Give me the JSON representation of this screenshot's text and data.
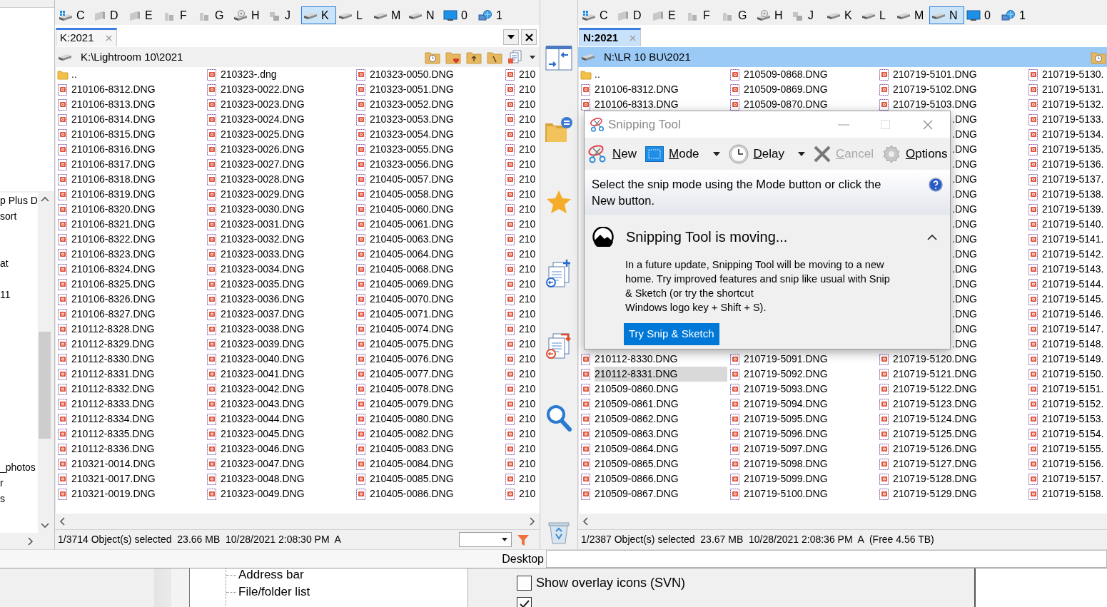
{
  "left_panel": {
    "tree_items": [
      "p Plus D",
      "sort",
      "at",
      "11",
      "_photos",
      "r",
      "s"
    ]
  },
  "panes": [
    {
      "active": false,
      "drives": [
        {
          "letter": "C",
          "kind": "system",
          "selected": false
        },
        {
          "letter": "D",
          "kind": "fixed",
          "selected": false
        },
        {
          "letter": "E",
          "kind": "fixed",
          "selected": false
        },
        {
          "letter": "F",
          "kind": "removable",
          "selected": false
        },
        {
          "letter": "G",
          "kind": "removable",
          "selected": false
        },
        {
          "letter": "H",
          "kind": "optical",
          "selected": false
        },
        {
          "letter": "J",
          "kind": "network",
          "selected": false
        },
        {
          "letter": "K",
          "kind": "hdd",
          "selected": true
        },
        {
          "letter": "L",
          "kind": "hdd",
          "selected": false
        },
        {
          "letter": "M",
          "kind": "hdd",
          "selected": false
        },
        {
          "letter": "N",
          "kind": "hdd",
          "selected": false
        },
        {
          "letter": "0",
          "kind": "desktop",
          "selected": false
        },
        {
          "letter": "1",
          "kind": "globe",
          "selected": false
        }
      ],
      "tab": "K:2021",
      "path": "K:\\Lightroom 10\\2021",
      "columns": [
        {
          "top": [
            {
              "name": "..",
              "kind": "up",
              "selected": false
            },
            {
              "name": "210106-8312.DNG",
              "kind": "file",
              "selected": false
            },
            {
              "name": "210106-8313.DNG",
              "kind": "file",
              "selected": false
            },
            {
              "name": "210106-8314.DNG",
              "kind": "file",
              "selected": false
            },
            {
              "name": "210106-8315.DNG",
              "kind": "file",
              "selected": false
            },
            {
              "name": "210106-8316.DNG",
              "kind": "file",
              "selected": false
            },
            {
              "name": "210106-8317.DNG",
              "kind": "file",
              "selected": false
            },
            {
              "name": "210106-8318.DNG",
              "kind": "file",
              "selected": false
            },
            {
              "name": "210106-8319.DNG",
              "kind": "file",
              "selected": false
            },
            {
              "name": "210106-8320.DNG",
              "kind": "file",
              "selected": false
            },
            {
              "name": "210106-8321.DNG",
              "kind": "file",
              "selected": false
            },
            {
              "name": "210106-8322.DNG",
              "kind": "file",
              "selected": false
            },
            {
              "name": "210106-8323.DNG",
              "kind": "file",
              "selected": false
            },
            {
              "name": "210106-8324.DNG",
              "kind": "file",
              "selected": false
            },
            {
              "name": "210106-8325.DNG",
              "kind": "file",
              "selected": false
            },
            {
              "name": "210106-8326.DNG",
              "kind": "file",
              "selected": false
            },
            {
              "name": "210106-8327.DNG",
              "kind": "file",
              "selected": false
            },
            {
              "name": "210112-8328.DNG",
              "kind": "file",
              "selected": false
            },
            {
              "name": "210112-8329.DNG",
              "kind": "file",
              "selected": false
            },
            {
              "name": "210112-8330.DNG",
              "kind": "file",
              "selected": false
            },
            {
              "name": "210112-8331.DNG",
              "kind": "file",
              "selected": false
            },
            {
              "name": "210112-8332.DNG",
              "kind": "file",
              "selected": false
            },
            {
              "name": "210112-8333.DNG",
              "kind": "file",
              "selected": false
            },
            {
              "name": "210112-8334.DNG",
              "kind": "file",
              "selected": false
            },
            {
              "name": "210112-8335.DNG",
              "kind": "file",
              "selected": false
            },
            {
              "name": "210112-8336.DNG",
              "kind": "file",
              "selected": false
            },
            {
              "name": "210321-0014.DNG",
              "kind": "file",
              "selected": false
            },
            {
              "name": "210321-0017.DNG",
              "kind": "file",
              "selected": false
            },
            {
              "name": "210321-0019.DNG",
              "kind": "file",
              "selected": false
            }
          ]
        },
        {
          "top": [
            {
              "name": "210323-.dng",
              "kind": "file",
              "selected": false
            },
            {
              "name": "210323-0022.DNG",
              "kind": "file",
              "selected": false
            },
            {
              "name": "210323-0023.DNG",
              "kind": "file",
              "selected": false
            },
            {
              "name": "210323-0024.DNG",
              "kind": "file",
              "selected": false
            },
            {
              "name": "210323-0025.DNG",
              "kind": "file",
              "selected": false
            },
            {
              "name": "210323-0026.DNG",
              "kind": "file",
              "selected": false
            },
            {
              "name": "210323-0027.DNG",
              "kind": "file",
              "selected": false
            },
            {
              "name": "210323-0028.DNG",
              "kind": "file",
              "selected": false
            },
            {
              "name": "210323-0029.DNG",
              "kind": "file",
              "selected": false
            },
            {
              "name": "210323-0030.DNG",
              "kind": "file",
              "selected": false
            },
            {
              "name": "210323-0031.DNG",
              "kind": "file",
              "selected": false
            },
            {
              "name": "210323-0032.DNG",
              "kind": "file",
              "selected": false
            },
            {
              "name": "210323-0033.DNG",
              "kind": "file",
              "selected": false
            },
            {
              "name": "210323-0034.DNG",
              "kind": "file",
              "selected": false
            },
            {
              "name": "210323-0035.DNG",
              "kind": "file",
              "selected": false
            },
            {
              "name": "210323-0036.DNG",
              "kind": "file",
              "selected": false
            },
            {
              "name": "210323-0037.DNG",
              "kind": "file",
              "selected": false
            },
            {
              "name": "210323-0038.DNG",
              "kind": "file",
              "selected": false
            },
            {
              "name": "210323-0039.DNG",
              "kind": "file",
              "selected": false
            },
            {
              "name": "210323-0040.DNG",
              "kind": "file",
              "selected": false
            },
            {
              "name": "210323-0041.DNG",
              "kind": "file",
              "selected": false
            },
            {
              "name": "210323-0042.DNG",
              "kind": "file",
              "selected": false
            },
            {
              "name": "210323-0043.DNG",
              "kind": "file",
              "selected": false
            },
            {
              "name": "210323-0044.DNG",
              "kind": "file",
              "selected": false
            },
            {
              "name": "210323-0045.DNG",
              "kind": "file",
              "selected": false
            },
            {
              "name": "210323-0046.DNG",
              "kind": "file",
              "selected": false
            },
            {
              "name": "210323-0047.DNG",
              "kind": "file",
              "selected": false
            },
            {
              "name": "210323-0048.DNG",
              "kind": "file",
              "selected": false
            },
            {
              "name": "210323-0049.DNG",
              "kind": "file",
              "selected": false
            }
          ]
        },
        {
          "top": [
            {
              "name": "210323-0050.DNG",
              "kind": "file",
              "selected": false
            },
            {
              "name": "210323-0051.DNG",
              "kind": "file",
              "selected": false
            },
            {
              "name": "210323-0052.DNG",
              "kind": "file",
              "selected": false
            },
            {
              "name": "210323-0053.DNG",
              "kind": "file",
              "selected": false
            },
            {
              "name": "210323-0054.DNG",
              "kind": "file",
              "selected": false
            },
            {
              "name": "210323-0055.DNG",
              "kind": "file",
              "selected": false
            },
            {
              "name": "210323-0056.DNG",
              "kind": "file",
              "selected": false
            },
            {
              "name": "210405-0057.DNG",
              "kind": "file",
              "selected": false
            },
            {
              "name": "210405-0058.DNG",
              "kind": "file",
              "selected": false
            },
            {
              "name": "210405-0060.DNG",
              "kind": "file",
              "selected": false
            },
            {
              "name": "210405-0061.DNG",
              "kind": "file",
              "selected": false
            },
            {
              "name": "210405-0063.DNG",
              "kind": "file",
              "selected": false
            },
            {
              "name": "210405-0064.DNG",
              "kind": "file",
              "selected": false
            },
            {
              "name": "210405-0068.DNG",
              "kind": "file",
              "selected": false
            },
            {
              "name": "210405-0069.DNG",
              "kind": "file",
              "selected": false
            },
            {
              "name": "210405-0070.DNG",
              "kind": "file",
              "selected": false
            },
            {
              "name": "210405-0071.DNG",
              "kind": "file",
              "selected": false
            },
            {
              "name": "210405-0074.DNG",
              "kind": "file",
              "selected": false
            },
            {
              "name": "210405-0075.DNG",
              "kind": "file",
              "selected": false
            },
            {
              "name": "210405-0076.DNG",
              "kind": "file",
              "selected": false
            },
            {
              "name": "210405-0077.DNG",
              "kind": "file",
              "selected": false
            },
            {
              "name": "210405-0078.DNG",
              "kind": "file",
              "selected": false
            },
            {
              "name": "210405-0079.DNG",
              "kind": "file",
              "selected": false
            },
            {
              "name": "210405-0080.DNG",
              "kind": "file",
              "selected": false
            },
            {
              "name": "210405-0082.DNG",
              "kind": "file",
              "selected": false
            },
            {
              "name": "210405-0083.DNG",
              "kind": "file",
              "selected": false
            },
            {
              "name": "210405-0084.DNG",
              "kind": "file",
              "selected": false
            },
            {
              "name": "210405-0085.DNG",
              "kind": "file",
              "selected": false
            },
            {
              "name": "210405-0086.DNG",
              "kind": "file",
              "selected": false
            }
          ]
        },
        {
          "top": [
            {
              "name": "210",
              "kind": "file",
              "selected": false
            },
            {
              "name": "210",
              "kind": "file",
              "selected": false
            },
            {
              "name": "210",
              "kind": "file",
              "selected": false
            },
            {
              "name": "210",
              "kind": "file",
              "selected": false
            },
            {
              "name": "210",
              "kind": "file",
              "selected": false
            },
            {
              "name": "210",
              "kind": "file",
              "selected": false
            },
            {
              "name": "210",
              "kind": "file",
              "selected": false
            },
            {
              "name": "210",
              "kind": "file",
              "selected": false
            },
            {
              "name": "210",
              "kind": "file",
              "selected": false
            },
            {
              "name": "210",
              "kind": "file",
              "selected": false
            },
            {
              "name": "210",
              "kind": "file",
              "selected": false
            },
            {
              "name": "210",
              "kind": "file",
              "selected": false
            },
            {
              "name": "210",
              "kind": "file",
              "selected": false
            },
            {
              "name": "210",
              "kind": "file",
              "selected": false
            },
            {
              "name": "210",
              "kind": "file",
              "selected": false
            },
            {
              "name": "210",
              "kind": "file",
              "selected": false
            },
            {
              "name": "210",
              "kind": "file",
              "selected": false
            },
            {
              "name": "210",
              "kind": "file",
              "selected": false
            },
            {
              "name": "210",
              "kind": "file",
              "selected": false
            },
            {
              "name": "210",
              "kind": "file",
              "selected": false
            },
            {
              "name": "210",
              "kind": "file",
              "selected": false
            },
            {
              "name": "210",
              "kind": "file",
              "selected": false
            },
            {
              "name": "210",
              "kind": "file",
              "selected": false
            },
            {
              "name": "210",
              "kind": "file",
              "selected": false
            },
            {
              "name": "210",
              "kind": "file",
              "selected": false
            },
            {
              "name": "210",
              "kind": "file",
              "selected": false
            },
            {
              "name": "210",
              "kind": "file",
              "selected": false
            },
            {
              "name": "210",
              "kind": "file",
              "selected": false
            },
            {
              "name": "210",
              "kind": "file",
              "selected": false
            }
          ]
        }
      ],
      "status": "1/3714 Object(s) selected  23.66 MB  10/28/2021 2:08:30 PM  A"
    },
    {
      "active": true,
      "drives": [
        {
          "letter": "C",
          "kind": "system",
          "selected": false
        },
        {
          "letter": "D",
          "kind": "fixed",
          "selected": false
        },
        {
          "letter": "E",
          "kind": "fixed",
          "selected": false
        },
        {
          "letter": "F",
          "kind": "removable",
          "selected": false
        },
        {
          "letter": "G",
          "kind": "removable",
          "selected": false
        },
        {
          "letter": "H",
          "kind": "optical",
          "selected": false
        },
        {
          "letter": "J",
          "kind": "network",
          "selected": false
        },
        {
          "letter": "K",
          "kind": "hdd",
          "selected": false
        },
        {
          "letter": "L",
          "kind": "hdd",
          "selected": false
        },
        {
          "letter": "M",
          "kind": "hdd",
          "selected": false
        },
        {
          "letter": "N",
          "kind": "hdd",
          "selected": true
        },
        {
          "letter": "0",
          "kind": "desktop",
          "selected": false
        },
        {
          "letter": "1",
          "kind": "globe",
          "selected": false
        }
      ],
      "tab": "N:2021",
      "path": "N:\\LR 10 BU\\2021",
      "columns": [
        {
          "top": [
            {
              "name": "..",
              "kind": "up",
              "selected": false
            },
            {
              "name": "210106-8312.DNG",
              "kind": "file",
              "selected": false
            },
            {
              "name": "210106-8313.DNG",
              "kind": "file",
              "selected": false
            }
          ],
          "bottom": [
            {
              "name": "210112-8330.DNG",
              "kind": "file",
              "selected": false
            },
            {
              "name": "210112-8331.DNG",
              "kind": "file",
              "selected": true
            },
            {
              "name": "210509-0860.DNG",
              "kind": "file",
              "selected": false
            },
            {
              "name": "210509-0861.DNG",
              "kind": "file",
              "selected": false
            },
            {
              "name": "210509-0862.DNG",
              "kind": "file",
              "selected": false
            },
            {
              "name": "210509-0863.DNG",
              "kind": "file",
              "selected": false
            },
            {
              "name": "210509-0864.DNG",
              "kind": "file",
              "selected": false
            },
            {
              "name": "210509-0865.DNG",
              "kind": "file",
              "selected": false
            },
            {
              "name": "210509-0866.DNG",
              "kind": "file",
              "selected": false
            },
            {
              "name": "210509-0867.DNG",
              "kind": "file",
              "selected": false
            }
          ]
        },
        {
          "top": [
            {
              "name": "210509-0868.DNG",
              "kind": "file",
              "selected": false
            },
            {
              "name": "210509-0869.DNG",
              "kind": "file",
              "selected": false
            },
            {
              "name": "210509-0870.DNG",
              "kind": "file",
              "selected": false
            }
          ],
          "bottom": [
            {
              "name": "210719-5091.DNG",
              "kind": "file",
              "selected": false
            },
            {
              "name": "210719-5092.DNG",
              "kind": "file",
              "selected": false
            },
            {
              "name": "210719-5093.DNG",
              "kind": "file",
              "selected": false
            },
            {
              "name": "210719-5094.DNG",
              "kind": "file",
              "selected": false
            },
            {
              "name": "210719-5095.DNG",
              "kind": "file",
              "selected": false
            },
            {
              "name": "210719-5096.DNG",
              "kind": "file",
              "selected": false
            },
            {
              "name": "210719-5097.DNG",
              "kind": "file",
              "selected": false
            },
            {
              "name": "210719-5098.DNG",
              "kind": "file",
              "selected": false
            },
            {
              "name": "210719-5099.DNG",
              "kind": "file",
              "selected": false
            },
            {
              "name": "210719-5100.DNG",
              "kind": "file",
              "selected": false
            }
          ]
        },
        {
          "top": [
            {
              "name": "210719-5101.DNG",
              "kind": "file",
              "selected": false
            },
            {
              "name": "210719-5102.DNG",
              "kind": "file",
              "selected": false
            },
            {
              "name": "210719-5103.DNG",
              "kind": "file",
              "selected": false
            },
            {
              "name": ".DNG",
              "kind": "clipped",
              "selected": false
            },
            {
              "name": ".DNG",
              "kind": "clipped",
              "selected": false
            },
            {
              "name": ".DNG",
              "kind": "clipped",
              "selected": false
            },
            {
              "name": ".DNG",
              "kind": "clipped",
              "selected": false
            },
            {
              "name": ".DNG",
              "kind": "clipped",
              "selected": false
            },
            {
              "name": ".DNG",
              "kind": "clipped",
              "selected": false
            },
            {
              "name": ".DNG",
              "kind": "clipped",
              "selected": false
            },
            {
              "name": ".DNG",
              "kind": "clipped",
              "selected": false
            },
            {
              "name": ".DNG",
              "kind": "clipped",
              "selected": false
            },
            {
              "name": ".DNG",
              "kind": "clipped",
              "selected": false
            },
            {
              "name": ".DNG",
              "kind": "clipped",
              "selected": false
            },
            {
              "name": ".DNG",
              "kind": "clipped",
              "selected": false
            },
            {
              "name": ".DNG",
              "kind": "clipped",
              "selected": false
            },
            {
              "name": ".DNG",
              "kind": "clipped",
              "selected": false
            },
            {
              "name": ".DNG",
              "kind": "clipped",
              "selected": false
            },
            {
              "name": ".DNG",
              "kind": "clipped",
              "selected": false
            },
            {
              "name": "210719-5120.DNG",
              "kind": "file",
              "selected": false
            },
            {
              "name": "210719-5121.DNG",
              "kind": "file",
              "selected": false
            },
            {
              "name": "210719-5122.DNG",
              "kind": "file",
              "selected": false
            },
            {
              "name": "210719-5123.DNG",
              "kind": "file",
              "selected": false
            },
            {
              "name": "210719-5124.DNG",
              "kind": "file",
              "selected": false
            },
            {
              "name": "210719-5125.DNG",
              "kind": "file",
              "selected": false
            },
            {
              "name": "210719-5126.DNG",
              "kind": "file",
              "selected": false
            },
            {
              "name": "210719-5127.DNG",
              "kind": "file",
              "selected": false
            },
            {
              "name": "210719-5128.DNG",
              "kind": "file",
              "selected": false
            },
            {
              "name": "210719-5129.DNG",
              "kind": "file",
              "selected": false
            }
          ]
        },
        {
          "top": [
            {
              "name": "210719-5130.",
              "kind": "file",
              "selected": false
            },
            {
              "name": "210719-5131.",
              "kind": "file",
              "selected": false
            },
            {
              "name": "210719-5132.",
              "kind": "file",
              "selected": false
            },
            {
              "name": "210719-5133.",
              "kind": "file",
              "selected": false
            },
            {
              "name": "210719-5134.",
              "kind": "file",
              "selected": false
            },
            {
              "name": "210719-5135.",
              "kind": "file",
              "selected": false
            },
            {
              "name": "210719-5136.",
              "kind": "file",
              "selected": false
            },
            {
              "name": "210719-5137.",
              "kind": "file",
              "selected": false
            },
            {
              "name": "210719-5138.",
              "kind": "file",
              "selected": false
            },
            {
              "name": "210719-5139.",
              "kind": "file",
              "selected": false
            },
            {
              "name": "210719-5140.",
              "kind": "file",
              "selected": false
            },
            {
              "name": "210719-5141.",
              "kind": "file",
              "selected": false
            },
            {
              "name": "210719-5142.",
              "kind": "file",
              "selected": false
            },
            {
              "name": "210719-5143.",
              "kind": "file",
              "selected": false
            },
            {
              "name": "210719-5144.",
              "kind": "file",
              "selected": false
            },
            {
              "name": "210719-5145.",
              "kind": "file",
              "selected": false
            },
            {
              "name": "210719-5146.",
              "kind": "file",
              "selected": false
            },
            {
              "name": "210719-5147.",
              "kind": "file",
              "selected": false
            },
            {
              "name": "210719-5148.",
              "kind": "file",
              "selected": false
            },
            {
              "name": "210719-5149.",
              "kind": "file",
              "selected": false
            },
            {
              "name": "210719-5150.",
              "kind": "file",
              "selected": false
            },
            {
              "name": "210719-5151.",
              "kind": "file",
              "selected": false
            },
            {
              "name": "210719-5152.",
              "kind": "file",
              "selected": false
            },
            {
              "name": "210719-5153.",
              "kind": "file",
              "selected": false
            },
            {
              "name": "210719-5154.",
              "kind": "file",
              "selected": false
            },
            {
              "name": "210719-5155.",
              "kind": "file",
              "selected": false
            },
            {
              "name": "210719-5156.",
              "kind": "file",
              "selected": false
            },
            {
              "name": "210719-5157.",
              "kind": "file",
              "selected": false
            },
            {
              "name": "210719-5158.",
              "kind": "file",
              "selected": false
            }
          ]
        }
      ],
      "status": "1/2387 Object(s) selected  23.67 MB  10/28/2021 2:08:36 PM  A  (Free 4.56 TB)"
    }
  ],
  "location_bar": {
    "label": "Desktop"
  },
  "options_behind": {
    "tree_items": [
      "Address bar",
      "File/folder list"
    ],
    "checkboxes": [
      {
        "label": "Show overlay icons (SVN)",
        "checked": false
      },
      {
        "checked": true
      }
    ]
  },
  "snipping_tool": {
    "title": "Snipping Tool",
    "toolbar": [
      {
        "label": "New",
        "kind": "new",
        "dropdown": false,
        "disabled": false
      },
      {
        "label": "Mode",
        "kind": "mode",
        "dropdown": true,
        "disabled": false
      },
      {
        "label": "Delay",
        "kind": "delay",
        "dropdown": true,
        "disabled": false
      },
      {
        "label": "Cancel",
        "kind": "cancel",
        "dropdown": false,
        "disabled": true
      },
      {
        "label": "Options",
        "kind": "options",
        "dropdown": false,
        "disabled": false
      }
    ],
    "instruction": "Select the snip mode using the Mode button or click the\nNew button.",
    "notice": {
      "title": "Snipping Tool is moving...",
      "expanded": true,
      "body": "In a future update, Snipping Tool will be moving to a new\nhome. Try improved features and snip like usual with Snip\n& Sketch (or try the shortcut\nWindows logo key + Shift + S).",
      "button": "Try Snip & Sketch"
    }
  }
}
